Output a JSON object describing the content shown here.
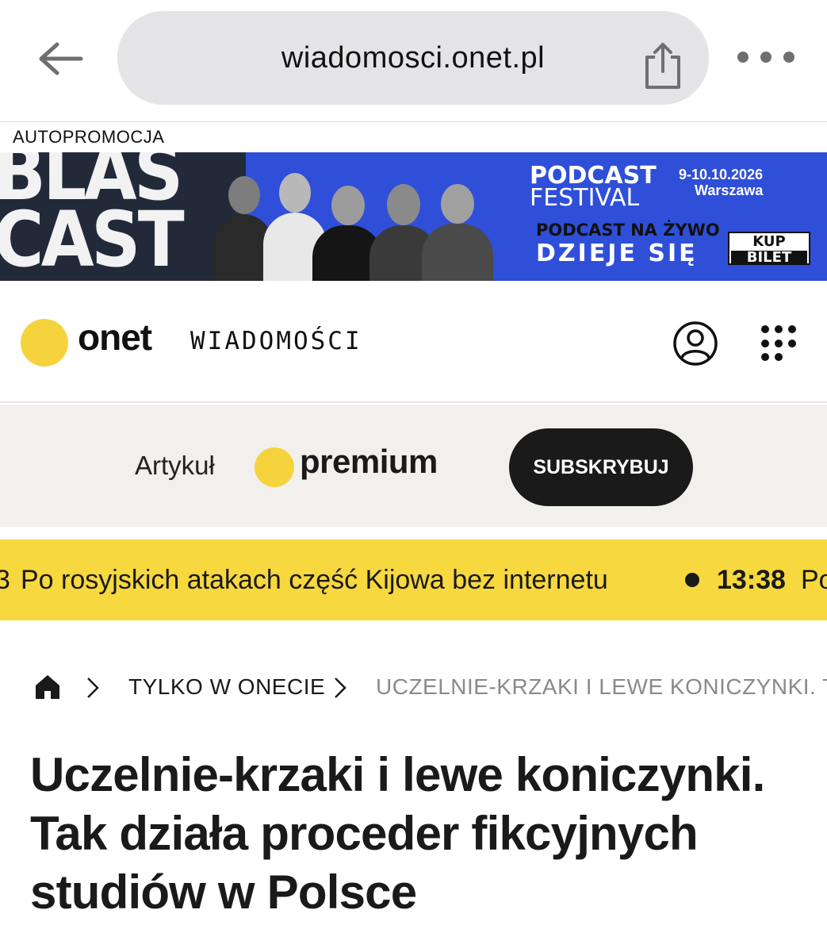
{
  "browser": {
    "url": "wiadomosci.onet.pl",
    "icons": {
      "back": "arrow-left-icon",
      "share": "share-icon",
      "more": "more-horizontal-icon"
    }
  },
  "ad": {
    "label": "AUTOPROMOCJA",
    "left_text": [
      "BLAS",
      "CAST"
    ],
    "festival_title": [
      "PODCAST",
      "FESTIVAL"
    ],
    "festival_date": "9-10.10.2026",
    "festival_city": "Warszawa",
    "tagline": "PODCAST NA ŻYWO",
    "headline": "DZIEJE SIĘ",
    "cta_top": "KUP",
    "cta_bottom": "BILET",
    "colors": {
      "blue": "#2f4fd8",
      "dark": "#222a3a"
    }
  },
  "header": {
    "brand": "onet",
    "section": "WIADOMOŚCI",
    "brand_color": "#f5d33c",
    "icons": {
      "user": "user-circle-icon",
      "apps": "apps-grid-icon"
    }
  },
  "premium": {
    "label": "Artykuł",
    "badge": "premium",
    "button": "SUBSKRYBUJ"
  },
  "ticker": {
    "prev_fragment": "3",
    "text": "Po rosyjskich atakach część Kijowa bez internetu",
    "time": "13:38",
    "next_fragment": "Po",
    "background": "#f7d83e"
  },
  "breadcrumb": {
    "items": [
      "TYLKO W ONECIE",
      "UCZELNIE-KRZAKI I LEWE KONICZYNKI. TA"
    ],
    "icons": {
      "home": "home-icon",
      "separator": "chevron-right-icon"
    }
  },
  "article": {
    "title": "Uczelnie-krzaki i lewe koniczynki. Tak działa proceder fikcyjnych studiów w Polsce"
  }
}
